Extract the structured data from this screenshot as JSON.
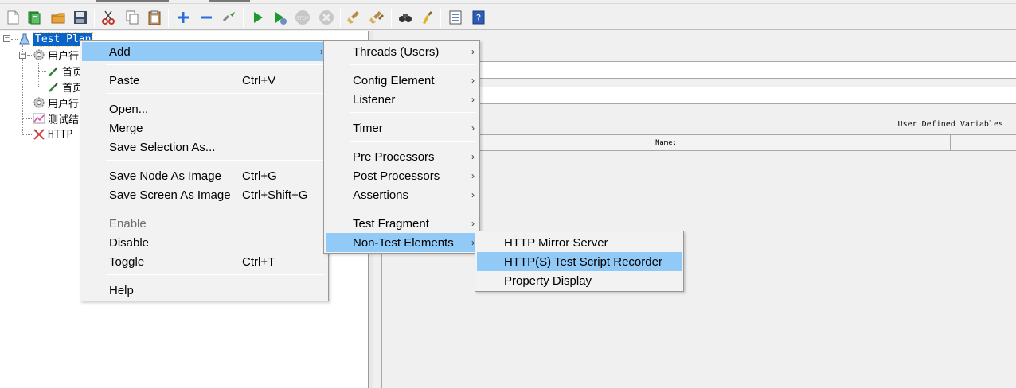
{
  "colors": {
    "selection": "#0a64c8",
    "menu_highlight": "#91c9f7",
    "menu_bg": "#f2f2f2"
  },
  "toolbar": {
    "buttons": [
      "new-icon",
      "templates-icon",
      "open-icon",
      "save-icon",
      "cut-icon",
      "copy-icon",
      "paste-icon",
      "expand-icon",
      "collapse-icon",
      "toggle-icon",
      "start-icon",
      "start-no-pause-icon",
      "stop-icon",
      "shutdown-icon",
      "clear-icon",
      "clear-all-icon",
      "search-icon",
      "reset-search-icon",
      "function-helper-icon",
      "help-icon"
    ]
  },
  "tree": {
    "root": "Test Plan",
    "items": [
      {
        "label": "用户行",
        "icon": "thread-group-icon"
      },
      {
        "label": "首页",
        "icon": "sampler-icon"
      },
      {
        "label": "首页",
        "icon": "sampler-icon"
      },
      {
        "label": "用户行",
        "icon": "thread-group-icon"
      },
      {
        "label": "测试结",
        "icon": "listener-icon"
      },
      {
        "label": "HTTP",
        "icon": "http-tool-icon"
      }
    ]
  },
  "right_panel": {
    "udv_title": "User Defined Variables",
    "name_column": "Name:"
  },
  "context_menu": {
    "add": "Add",
    "paste": "Paste",
    "paste_shortcut": "Ctrl+V",
    "open": "Open...",
    "merge": "Merge",
    "save_selection": "Save Selection As...",
    "save_node_image": "Save Node As Image",
    "save_node_image_shortcut": "Ctrl+G",
    "save_screen_image": "Save Screen As Image",
    "save_screen_image_shortcut": "Ctrl+Shift+G",
    "enable": "Enable",
    "disable": "Disable",
    "toggle": "Toggle",
    "toggle_shortcut": "Ctrl+T",
    "help": "Help"
  },
  "add_submenu": {
    "threads": "Threads (Users)",
    "config": "Config Element",
    "listener": "Listener",
    "timer": "Timer",
    "pre": "Pre Processors",
    "post": "Post Processors",
    "assertions": "Assertions",
    "fragment": "Test Fragment",
    "non_test": "Non-Test Elements"
  },
  "non_test_submenu": {
    "mirror": "HTTP Mirror Server",
    "recorder": "HTTP(S) Test Script Recorder",
    "property": "Property Display"
  }
}
